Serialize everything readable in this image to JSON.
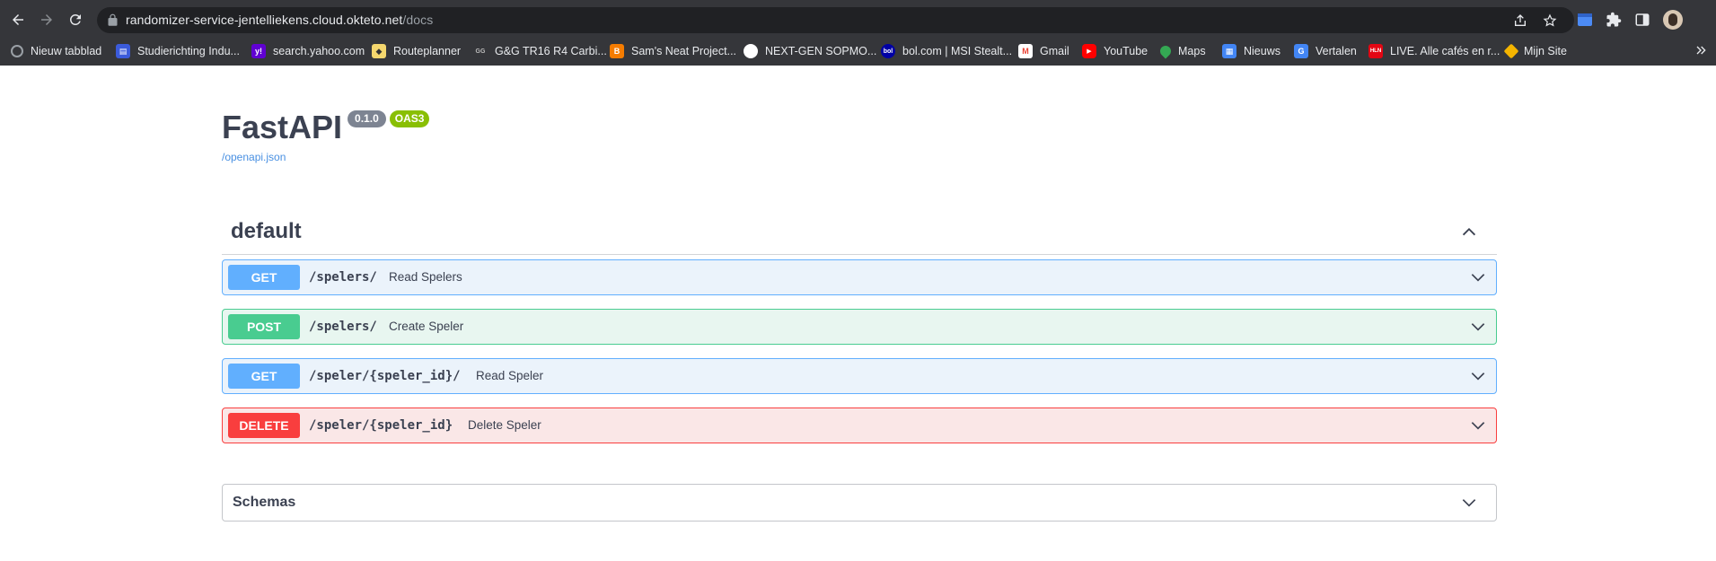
{
  "browser": {
    "url_host": "randomizer-service-jentelliekens.cloud.okteto.net",
    "url_path": "/docs",
    "bookmarks": [
      {
        "label": "Nieuw tabblad",
        "icon": "globe-icon",
        "color": "#9aa0a6"
      },
      {
        "label": "Studierichting Indu...",
        "icon": "studierichting-icon",
        "color": "#3b5bdb"
      },
      {
        "label": "search.yahoo.com",
        "icon": "yahoo-icon",
        "color": "#6001d2"
      },
      {
        "label": "Routeplanner",
        "icon": "routeplanner-icon",
        "color": "#f5d76e"
      },
      {
        "label": "G&G TR16 R4 Carbi...",
        "icon": "gg-icon",
        "color": "#35363a"
      },
      {
        "label": "Sam's Neat Project...",
        "icon": "blogger-icon",
        "color": "#f57c00"
      },
      {
        "label": "NEXT-GEN SOPMO...",
        "icon": "circle-icon",
        "color": "#ffffff"
      },
      {
        "label": "bol.com | MSI Stealt...",
        "icon": "bol-icon",
        "color": "#0000a4"
      },
      {
        "label": "Gmail",
        "icon": "gmail-icon",
        "color": "#ea4335"
      },
      {
        "label": "YouTube",
        "icon": "youtube-icon",
        "color": "#ff0000"
      },
      {
        "label": "Maps",
        "icon": "maps-icon",
        "color": "#34a853"
      },
      {
        "label": "Nieuws",
        "icon": "news-icon",
        "color": "#4285f4"
      },
      {
        "label": "Vertalen",
        "icon": "translate-icon",
        "color": "#4285f4"
      },
      {
        "label": "LIVE. Alle cafés en r...",
        "icon": "hln-icon",
        "color": "#e30613"
      },
      {
        "label": "Mijn Site",
        "icon": "site-icon",
        "color": "#f4b400"
      }
    ]
  },
  "info": {
    "title": "FastAPI",
    "version": "0.1.0",
    "oas": "OAS3",
    "spec_link": "/openapi.json"
  },
  "tag": {
    "name": "default"
  },
  "operations": [
    {
      "method": "GET",
      "path": "/spelers/",
      "summary": "Read Spelers"
    },
    {
      "method": "POST",
      "path": "/spelers/",
      "summary": "Create Speler"
    },
    {
      "method": "GET",
      "path": "/speler/{speler_id}/",
      "summary": "Read Speler"
    },
    {
      "method": "DELETE",
      "path": "/speler/{speler_id}",
      "summary": "Delete Speler"
    }
  ],
  "schemas": {
    "label": "Schemas"
  },
  "colors": {
    "get": "#61affe",
    "post": "#49cc90",
    "delete": "#f93e3e",
    "text": "#3b4151"
  }
}
